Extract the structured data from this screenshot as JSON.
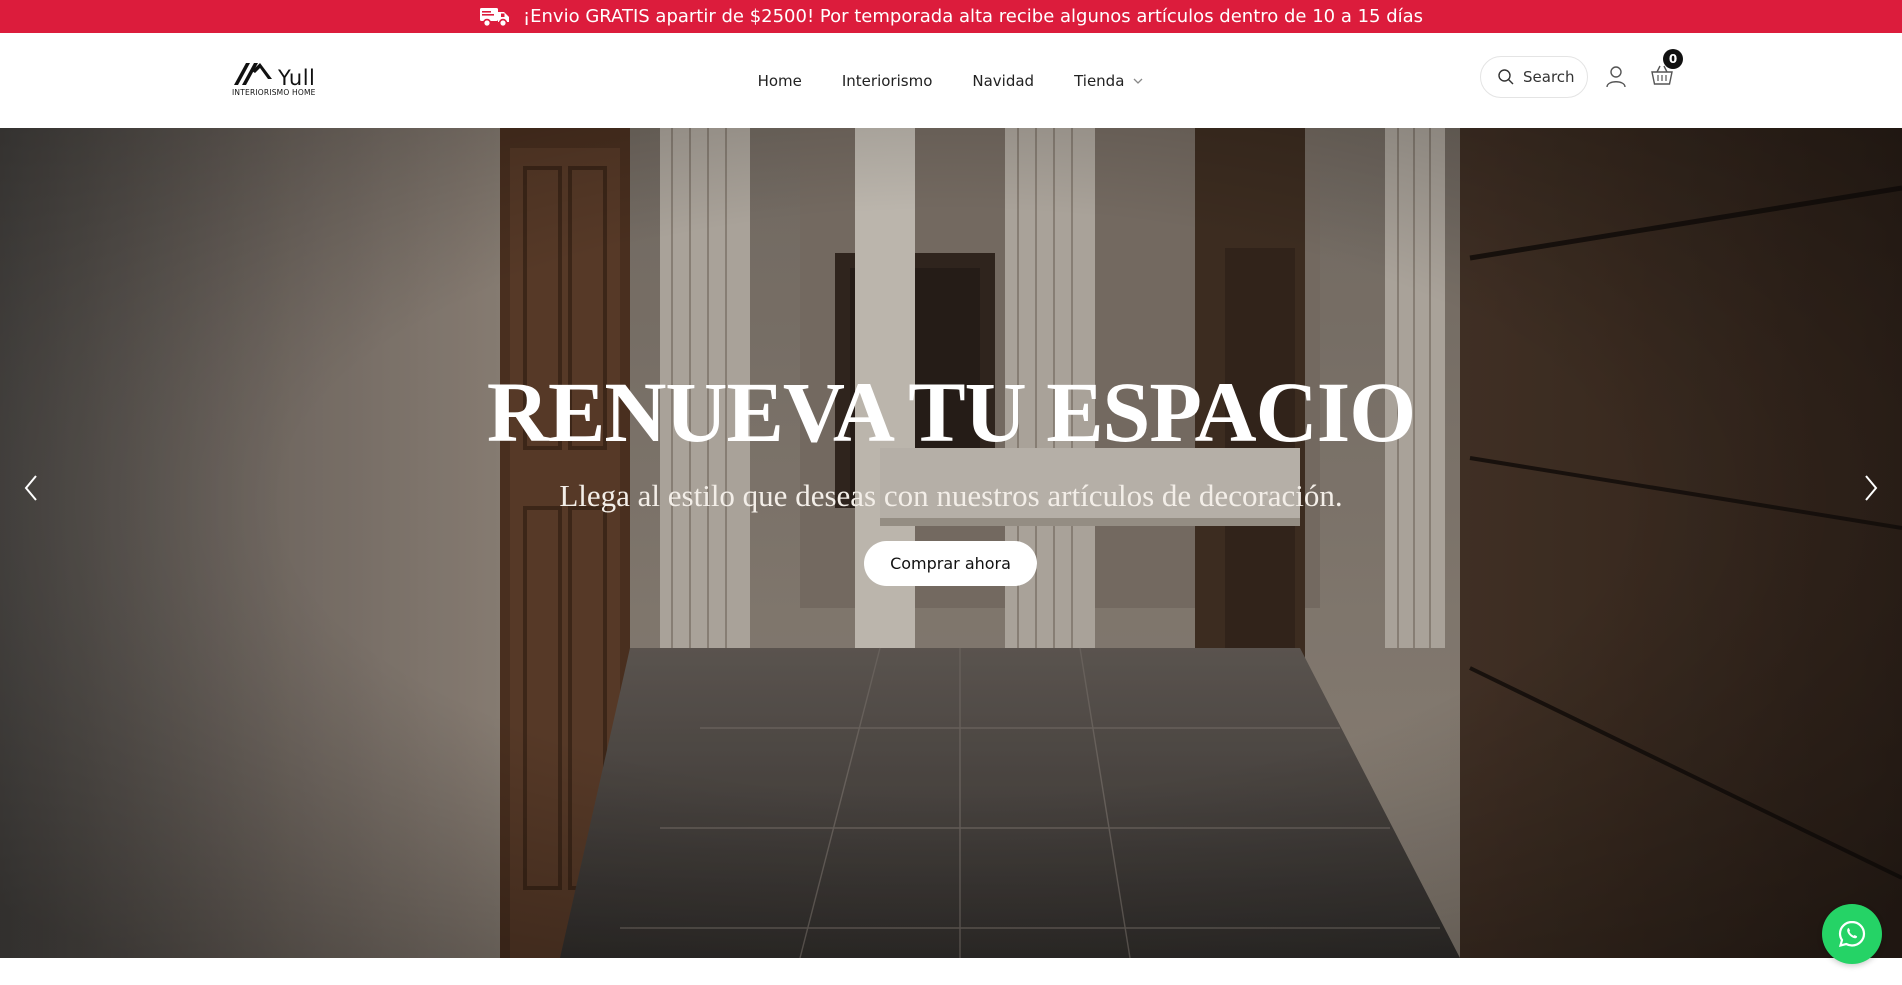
{
  "announcement": {
    "text": "¡Envio GRATIS apartir de $2500! Por temporada alta recibe algunos artículos dentro de 10 a 15 días",
    "icon": "delivery-truck-icon",
    "background": "#dc1c3c"
  },
  "header": {
    "logo": {
      "brand": "Yull",
      "tagline": "INTERIORISMO HOME"
    },
    "nav": [
      {
        "label": "Home"
      },
      {
        "label": "Interiorismo"
      },
      {
        "label": "Navidad"
      },
      {
        "label": "Tienda",
        "icon": "chevron-down-icon"
      }
    ],
    "search": {
      "label": "Search",
      "icon": "search-icon"
    },
    "account": {
      "icon": "user-icon"
    },
    "cart": {
      "icon": "basket-icon",
      "count": "0"
    }
  },
  "hero": {
    "title": "RENUEVA TU ESPACIO",
    "subtitle": "Llega al estilo que deseas con nuestros artículos de decoración.",
    "cta_label": "Comprar ahora",
    "prev_icon": "chevron-left-icon",
    "next_icon": "chevron-right-icon"
  },
  "whatsapp": {
    "icon": "whatsapp-icon",
    "color": "#25d366"
  }
}
